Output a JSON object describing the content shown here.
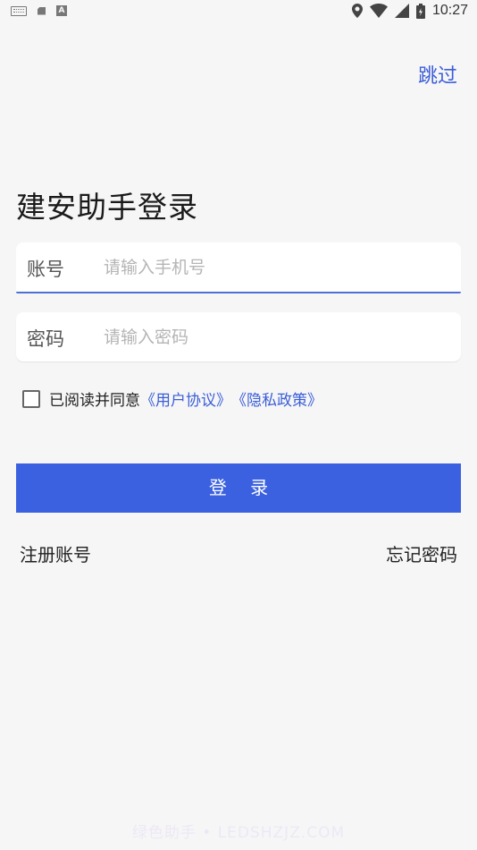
{
  "status_bar": {
    "time": "10:27",
    "left_icons": [
      "keyboard-icon",
      "sd-card-icon",
      "a-notification-icon"
    ],
    "right_icons": [
      "location-icon",
      "wifi-icon",
      "signal-icon",
      "battery-icon"
    ]
  },
  "header": {
    "skip_label": "跳过"
  },
  "page": {
    "title": "建安助手登录"
  },
  "form": {
    "account_label": "账号",
    "account_placeholder": "请输入手机号",
    "account_value": "",
    "password_label": "密码",
    "password_placeholder": "请输入密码",
    "password_value": ""
  },
  "agreement": {
    "checked": false,
    "prefix": "已阅读并同意",
    "user_agreement": "《用户协议》",
    "privacy_policy": "《隐私政策》"
  },
  "actions": {
    "login_label": "登 录",
    "register_label": "注册账号",
    "forgot_label": "忘记密码"
  },
  "watermark": "绿色助手 • LEDSHZJZ.COM",
  "colors": {
    "accent": "#3b61e0",
    "link": "#3b5ed8",
    "background": "#f6f6f6"
  }
}
